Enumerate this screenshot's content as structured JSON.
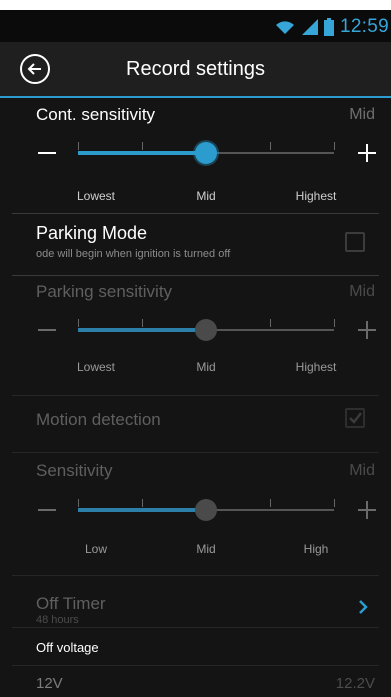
{
  "status": {
    "time": "12:59"
  },
  "header": {
    "title": "Record settings"
  },
  "cont": {
    "label": "Cont. sensitivity",
    "value": "Mid",
    "level": 0.5,
    "labels": [
      "Lowest",
      "Mid",
      "Highest"
    ]
  },
  "parking_mode": {
    "label": "Parking Mode",
    "desc": "ode will begin when ignition is turned off",
    "checked": false
  },
  "parking_sensitivity": {
    "label": "Parking sensitivity",
    "value": "Mid",
    "level": 0.5,
    "labels": [
      "Lowest",
      "Mid",
      "Highest"
    ]
  },
  "motion": {
    "label": "Motion detection",
    "checked": true
  },
  "sensitivity": {
    "label": "Sensitivity",
    "value": "Mid",
    "level": 0.5,
    "labels": [
      "Low",
      "Mid",
      "High"
    ]
  },
  "off_timer": {
    "label": "Off Timer",
    "value": "48 hours"
  },
  "off_voltage": {
    "label": "Off voltage",
    "left": "12V",
    "right": "12.2V"
  },
  "colors": {
    "accent": "#2c9ccf",
    "background": "#141414",
    "disabled": "#5f5f5f"
  },
  "icons": [
    "wifi-icon",
    "signal-icon",
    "battery-icon",
    "back-arrow-icon",
    "plus-icon",
    "minus-icon",
    "chevron-right-icon",
    "checkbox-icon"
  ]
}
